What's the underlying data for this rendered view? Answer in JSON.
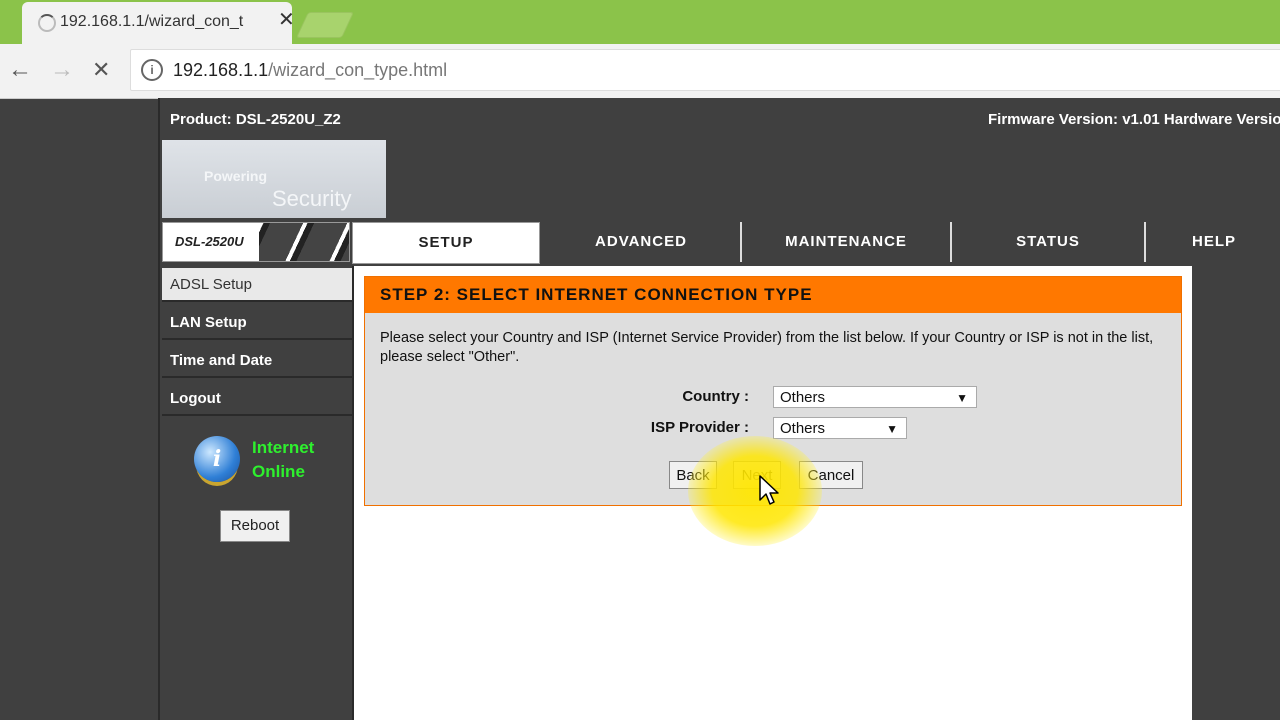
{
  "browser": {
    "tab_title": "192.168.1.1/wizard_con_t",
    "close_glyph": "✕",
    "back_glyph": "←",
    "forward_glyph": "→",
    "stop_glyph": "✕",
    "url_host": "192.168.1.1",
    "url_path": "/wizard_con_type.html"
  },
  "router": {
    "product": "Product: DSL-2520U_Z2",
    "firmware": "Firmware Version: v1.01 Hardware Versio",
    "logo_line1": "Powering",
    "logo_line2": "Security",
    "model": "DSL-2520U",
    "nav": [
      "SETUP",
      "ADVANCED",
      "MAINTENANCE",
      "STATUS",
      "HELP"
    ],
    "sidebar": [
      "ADSL Setup",
      "LAN Setup",
      "Time and Date",
      "Logout"
    ],
    "internet_status_1": "Internet",
    "internet_status_2": "Online",
    "reboot": "Reboot"
  },
  "wizard": {
    "header": "STEP 2: SELECT INTERNET CONNECTION TYPE",
    "description": "Please select your Country and ISP (Internet Service Provider) from the list below. If your Country or ISP is not in the list, please select \"Other\".",
    "country_label": "Country :",
    "country_value": "Others",
    "isp_label": "ISP Provider :",
    "isp_value": "Others",
    "dropdown_glyph": "▼",
    "back": "Back",
    "next": "Next",
    "cancel": "Cancel"
  },
  "colors": {
    "tabstrip": "#8bc34a",
    "router_bg": "#404040",
    "wizard_header": "#ff7800",
    "internet_online": "#2ef02e",
    "cursor_highlight": "#ffe600"
  }
}
